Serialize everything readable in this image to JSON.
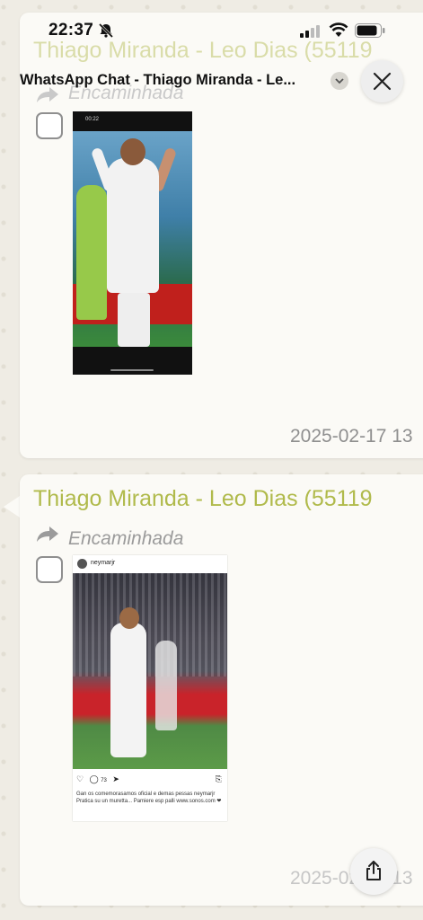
{
  "status": {
    "time": "22:37"
  },
  "header": {
    "title": "WhatsApp Chat - Thiago Miranda - Le..."
  },
  "messages": [
    {
      "sender": "Thiago Miranda - Leo Dias (55119",
      "forwarded": "Encaminhada",
      "timestamp": "2025-02-17 13",
      "media": "instagram-story-screenshot",
      "story_time": "00:22"
    },
    {
      "sender": "Thiago Miranda - Leo Dias (55119",
      "forwarded": "Encaminhada",
      "timestamp": "2025-02-17 13",
      "media": "instagram-post-screenshot",
      "post_user": "neymarjr",
      "post_likes": "73",
      "post_caption": "Gan os comemorasamos oficial e demas pessas neymarjr Pratica su un muretta... Pamiere esp palli www.sonos.com ❤"
    }
  ],
  "colors": {
    "sender": "#b0ba4b",
    "background": "#efece4",
    "card": "#fbfaf6"
  },
  "icons": [
    "bell-slash-icon",
    "signal-icon",
    "wifi-icon",
    "battery-icon",
    "chevron-down-icon",
    "close-icon",
    "forward-arrow-icon",
    "share-icon"
  ]
}
